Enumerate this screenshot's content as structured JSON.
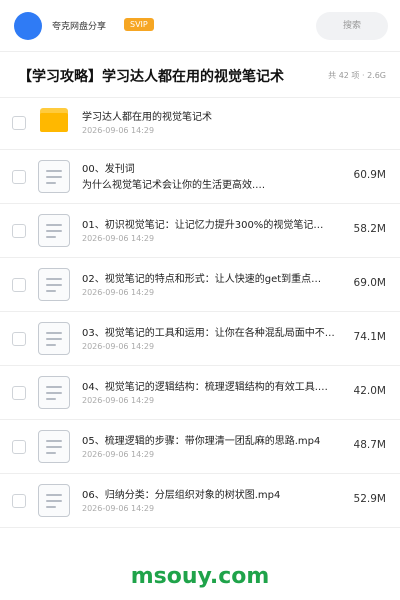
{
  "topbar": {
    "user_name": "夸克网盘分享",
    "badge": "SVIP",
    "search_placeholder": "搜索"
  },
  "header": {
    "title": "【学习攻略】学习达人都在用的视觉笔记术",
    "summary": "共 42 项 · 2.6G"
  },
  "files": [
    {
      "type": "folder",
      "name": "学习达人都在用的视觉笔记术",
      "date": "2026-09-06 14:29",
      "size": ""
    },
    {
      "type": "file",
      "name": "00、发刊词",
      "subtitle": "为什么视觉笔记术会让你的生活更高效.…",
      "size": "60.9M"
    },
    {
      "type": "file",
      "name": "01、初识视觉笔记：让记忆力提升300%的视觉笔记…",
      "date": "2026-09-06 14:29",
      "size": "58.2M"
    },
    {
      "type": "file",
      "name": "02、视觉笔记的特点和形式：让人快速的get到重点…",
      "date": "2026-09-06 14:29",
      "size": "69.0M"
    },
    {
      "type": "file",
      "name": "03、视觉笔记的工具和运用：让你在各种混乱局面中不…",
      "date": "2026-09-06 14:29",
      "size": "74.1M"
    },
    {
      "type": "file",
      "name": "04、视觉笔记的逻辑结构：梳理逻辑结构的有效工具.…",
      "date": "2026-09-06 14:29",
      "size": "42.0M"
    },
    {
      "type": "file",
      "name": "05、梳理逻辑的步骤：带你理清一团乱麻的思路.mp4",
      "date": "2026-09-06 14:29",
      "size": "48.7M"
    },
    {
      "type": "file",
      "name": "06、归纳分类：分层组织对象的树状图.mp4",
      "date": "2026-09-06 14:29",
      "size": "52.9M"
    }
  ],
  "watermark": "msouy.com",
  "colors": {
    "accent": "#2f7bf5",
    "badge": "#f6a623",
    "folder": "#ffb800",
    "watermark": "#1fa34a"
  }
}
